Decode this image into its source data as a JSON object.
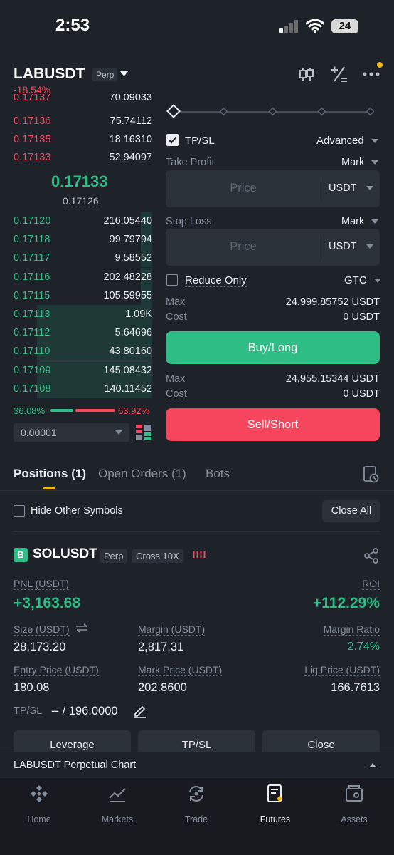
{
  "status_bar": {
    "time": "2:53",
    "battery": "24"
  },
  "header": {
    "symbol": "LABUSDT",
    "tag": "Perp",
    "change": "-18.54%"
  },
  "order_book": {
    "asks": [
      {
        "price": "0.17137",
        "qty": "70.09033"
      },
      {
        "price": "0.17136",
        "qty": "75.74112"
      },
      {
        "price": "0.17135",
        "qty": "18.16310"
      },
      {
        "price": "0.17133",
        "qty": "52.94097"
      }
    ],
    "mid_price": "0.17133",
    "mark_price": "0.17126",
    "bids": [
      {
        "price": "0.17120",
        "qty": "216.05440",
        "depth": 0.08
      },
      {
        "price": "0.17118",
        "qty": "99.79794",
        "depth": 0.08
      },
      {
        "price": "0.17117",
        "qty": "9.58552",
        "depth": 0.08
      },
      {
        "price": "0.17116",
        "qty": "202.48228",
        "depth": 0.08
      },
      {
        "price": "0.17115",
        "qty": "105.59955",
        "depth": 0.08
      },
      {
        "price": "0.17113",
        "qty": "1.09K",
        "depth": 0.83
      },
      {
        "price": "0.17112",
        "qty": "5.64696",
        "depth": 0.83
      },
      {
        "price": "0.17110",
        "qty": "43.80160",
        "depth": 0.83
      },
      {
        "price": "0.17109",
        "qty": "145.08432",
        "depth": 0.83
      },
      {
        "price": "0.17108",
        "qty": "140.11452",
        "depth": 0.83
      }
    ],
    "buy_ratio": "36.08%",
    "sell_ratio": "63.92%",
    "precision": "0.00001"
  },
  "form": {
    "tpsl_label": "TP/SL",
    "advanced": "Advanced",
    "take_profit_label": "Take Profit",
    "take_profit_type": "Mark",
    "tp_placeholder": "Price",
    "tp_unit": "USDT",
    "stop_loss_label": "Stop Loss",
    "stop_loss_type": "Mark",
    "sl_placeholder": "Price",
    "sl_unit": "USDT",
    "reduce_only": "Reduce Only",
    "tif": "GTC",
    "buy": {
      "max_label": "Max",
      "max_value": "24,999.85752 USDT",
      "cost_label": "Cost",
      "cost_value": "0 USDT",
      "button": "Buy/Long"
    },
    "sell": {
      "max_label": "Max",
      "max_value": "24,955.15344 USDT",
      "cost_label": "Cost",
      "cost_value": "0 USDT",
      "button": "Sell/Short"
    }
  },
  "tabs": {
    "positions": "Positions (1)",
    "open_orders": "Open Orders (1)",
    "bots": "Bots"
  },
  "filters": {
    "hide_other": "Hide Other Symbols",
    "close_all": "Close All"
  },
  "position": {
    "side_badge": "B",
    "symbol": "SOLUSDT",
    "tag_perp": "Perp",
    "tag_margin": "Cross 10X",
    "alert": "!!!!",
    "pnl_label": "PNL (USDT)",
    "pnl_value": "+3,163.68",
    "roi_label": "ROI",
    "roi_value": "+112.29%",
    "size_label": "Size (USDT)",
    "size_value": "28,173.20",
    "margin_label": "Margin (USDT)",
    "margin_value": "2,817.31",
    "margin_ratio_label": "Margin Ratio",
    "margin_ratio_value": "2.74%",
    "entry_label": "Entry Price (USDT)",
    "entry_value": "180.08",
    "mark_label": "Mark Price (USDT)",
    "mark_value": "202.8600",
    "liq_label": "Liq.Price (USDT)",
    "liq_value": "166.7613",
    "tpsl_label": "TP/SL",
    "tpsl_value": "-- / 196.0000",
    "buttons": {
      "leverage": "Leverage",
      "tpsl": "TP/SL",
      "close": "Close"
    }
  },
  "chart_strip": {
    "label": "LABUSDT Perpetual  Chart"
  },
  "nav": {
    "home": "Home",
    "markets": "Markets",
    "trade": "Trade",
    "futures": "Futures",
    "assets": "Assets"
  },
  "colors": {
    "green": "#2ebd85",
    "red": "#f6465d",
    "accent": "#f0b90b",
    "bg": "#1e2329"
  }
}
